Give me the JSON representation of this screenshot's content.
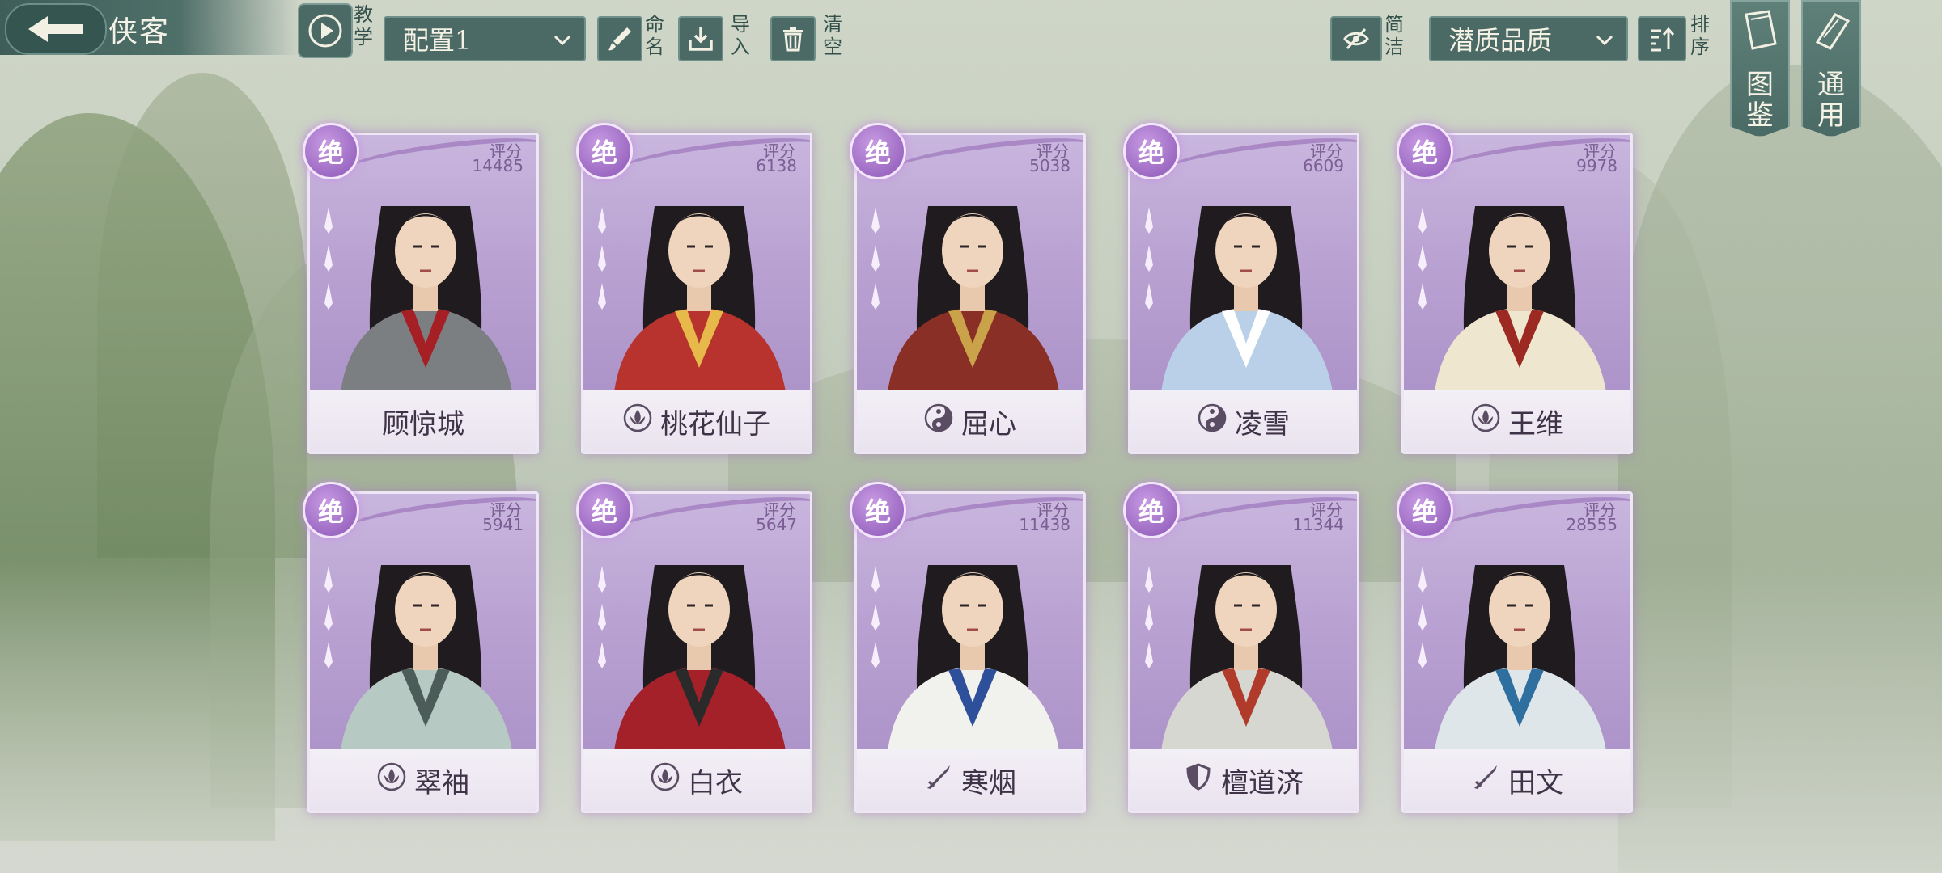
{
  "header": {
    "title": "侠客",
    "tutorial_label": "教学",
    "config_select": "配置1",
    "rename_label": "命名",
    "import_label": "导入",
    "clear_label": "清空",
    "simple_label": "简洁",
    "sort_select": "潜质品质",
    "sort_label": "排序",
    "codex_label": "图鉴",
    "general_label": "通用"
  },
  "score_label": "评分",
  "cards": [
    {
      "name": "顾惊城",
      "score": "14485",
      "grade": "绝",
      "sect_icon": "none",
      "robe": "#7b7f82",
      "accent": "#a51f25"
    },
    {
      "name": "桃花仙子",
      "score": "6138",
      "grade": "绝",
      "sect_icon": "lotus-icon",
      "robe": "#b8332e",
      "accent": "#e7b84a"
    },
    {
      "name": "屈心",
      "score": "5038",
      "grade": "绝",
      "sect_icon": "taiji-icon",
      "robe": "#8a2f26",
      "accent": "#c9a24a"
    },
    {
      "name": "凌雪",
      "score": "6609",
      "grade": "绝",
      "sect_icon": "taiji-icon",
      "robe": "#b9d0e8",
      "accent": "#ffffff"
    },
    {
      "name": "王维",
      "score": "9978",
      "grade": "绝",
      "sect_icon": "lotus-icon",
      "robe": "#efe6cf",
      "accent": "#9c2a22"
    },
    {
      "name": "翠袖",
      "score": "5941",
      "grade": "绝",
      "sect_icon": "lotus-icon",
      "robe": "#b7c9c3",
      "accent": "#4c5c58"
    },
    {
      "name": "白衣",
      "score": "5647",
      "grade": "绝",
      "sect_icon": "lotus-icon",
      "robe": "#a4212a",
      "accent": "#2a2a2a"
    },
    {
      "name": "寒烟",
      "score": "11438",
      "grade": "绝",
      "sect_icon": "sword-icon",
      "robe": "#f1f1ee",
      "accent": "#2e4f9a"
    },
    {
      "name": "檀道济",
      "score": "11344",
      "grade": "绝",
      "sect_icon": "shield-icon",
      "robe": "#d7d7d2",
      "accent": "#b13b2a"
    },
    {
      "name": "田文",
      "score": "28555",
      "grade": "绝",
      "sect_icon": "sword-icon",
      "robe": "#dfe6ea",
      "accent": "#2f6fa0"
    }
  ]
}
